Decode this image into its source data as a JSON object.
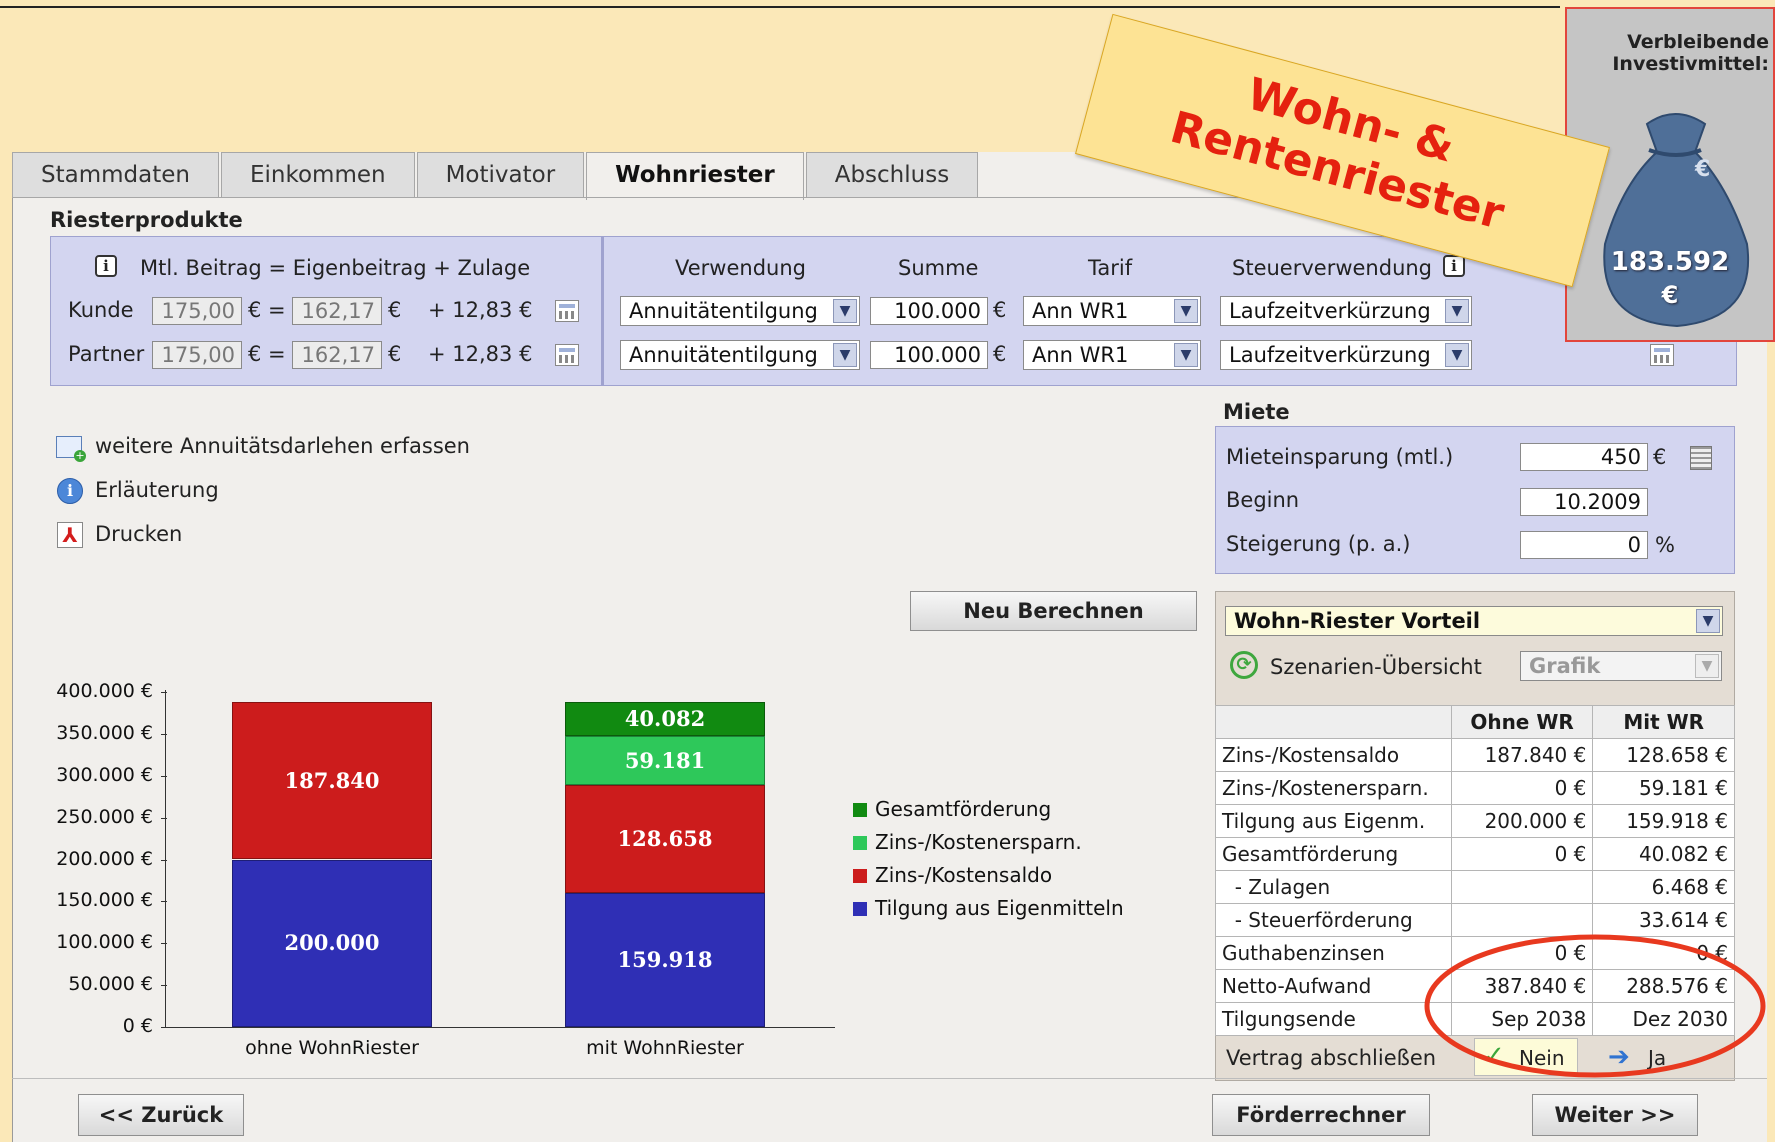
{
  "tabs": [
    "Stammdaten",
    "Einkommen",
    "Motivator",
    "Wohnriester",
    "Abschluss"
  ],
  "active_tab": "Wohnriester",
  "riester": {
    "title": "Riesterprodukte",
    "formula": "Mtl. Beitrag = Eigenbeitrag + Zulage",
    "rows": [
      {
        "label": "Kunde",
        "beitrag": "175,00",
        "eigen": "162,17",
        "zulage": "+ 12,83 €"
      },
      {
        "label": "Partner",
        "beitrag": "175,00",
        "eigen": "162,17",
        "zulage": "+ 12,83 €"
      }
    ],
    "eq": "€ =",
    "eur": "€",
    "headers": {
      "verwendung": "Verwendung",
      "summe": "Summe",
      "tarif": "Tarif",
      "steuer": "Steuerverwendung"
    },
    "products": [
      {
        "verwendung": "Annuitätentilgung",
        "summe": "100.000",
        "tarif": "Ann WR1",
        "steuer": "Laufzeitverkürzung"
      },
      {
        "verwendung": "Annuitätentilgung",
        "summe": "100.000",
        "tarif": "Ann WR1",
        "steuer": "Laufzeitverkürzung"
      }
    ]
  },
  "links": {
    "annuitaet": "weitere Annuitätsdarlehen erfassen",
    "erlaeuterung": "Erläuterung",
    "drucken": "Drucken"
  },
  "miete": {
    "title": "Miete",
    "einsparung_label": "Mieteinsparung (mtl.)",
    "einsparung_value": "450",
    "einsparung_unit": "€",
    "beginn_label": "Beginn",
    "beginn_value": "10.2009",
    "steigerung_label": "Steigerung (p. a.)",
    "steigerung_value": "0",
    "steigerung_unit": "%"
  },
  "buttons": {
    "neu_berechnen": "Neu Berechnen",
    "zurueck": "<< Zurück",
    "foerderrechner": "Förderrechner",
    "weiter": "Weiter >>"
  },
  "vorteil": {
    "select": "Wohn-Riester Vorteil",
    "szenarien": "Szenarien-Übersicht",
    "grafik": "Grafik"
  },
  "table": {
    "headers": [
      "",
      "Ohne WR",
      "Mit WR"
    ],
    "rows": [
      [
        "Zins-/Kostensaldo",
        "187.840 €",
        "128.658 €"
      ],
      [
        "Zins-/Kostenersparn.",
        "0 €",
        "59.181 €"
      ],
      [
        "Tilgung aus Eigenm.",
        "200.000 €",
        "159.918 €"
      ],
      [
        "Gesamtförderung",
        "0 €",
        "40.082 €"
      ],
      [
        "  - Zulagen",
        "",
        "6.468 €"
      ],
      [
        "  - Steuerförderung",
        "",
        "33.614 €"
      ],
      [
        "Guthabenzinsen",
        "0 €",
        "0 €"
      ],
      [
        "Netto-Aufwand",
        "387.840 €",
        "288.576 €"
      ],
      [
        "Tilgungsende",
        "Sep 2038",
        "Dez 2030"
      ]
    ],
    "vertrag_label": "Vertrag abschließen",
    "nein": "Nein",
    "ja": "Ja"
  },
  "promo": {
    "line1": "Wohn- &",
    "line2": "Rentenriester",
    "box_title_1": "Verbleibende",
    "box_title_2": "Investivmittel:",
    "box_value": "183.592",
    "box_unit": "€"
  },
  "chart_data": {
    "type": "bar",
    "stacked": true,
    "categories": [
      "ohne WohnRiester",
      "mit WohnRiester"
    ],
    "series": [
      {
        "name": "Tilgung aus Eigenmitteln",
        "values": [
          200000,
          159918
        ],
        "labels": [
          "200.000",
          "159.918"
        ],
        "color": "#2f2fb5"
      },
      {
        "name": "Zins-/Kostensaldo",
        "values": [
          187840,
          128658
        ],
        "labels": [
          "187.840",
          "128.658"
        ],
        "color": "#cc1c1c"
      },
      {
        "name": "Zins-/Kostenersparn.",
        "values": [
          0,
          59181
        ],
        "labels": [
          "",
          "59.181"
        ],
        "color": "#2ec85a"
      },
      {
        "name": "Gesamtförderung",
        "values": [
          0,
          40082
        ],
        "labels": [
          "",
          "40.082"
        ],
        "color": "#118a11"
      }
    ],
    "legend_order": [
      "Gesamtförderung",
      "Zins-/Kostenersparn.",
      "Zins-/Kostensaldo",
      "Tilgung aus Eigenmitteln"
    ],
    "ylim": [
      0,
      400000
    ],
    "yticks": [
      "0 €",
      "50.000 €",
      "100.000 €",
      "150.000 €",
      "200.000 €",
      "250.000 €",
      "300.000 €",
      "350.000 €",
      "400.000 €"
    ],
    "legend_position": "right"
  }
}
